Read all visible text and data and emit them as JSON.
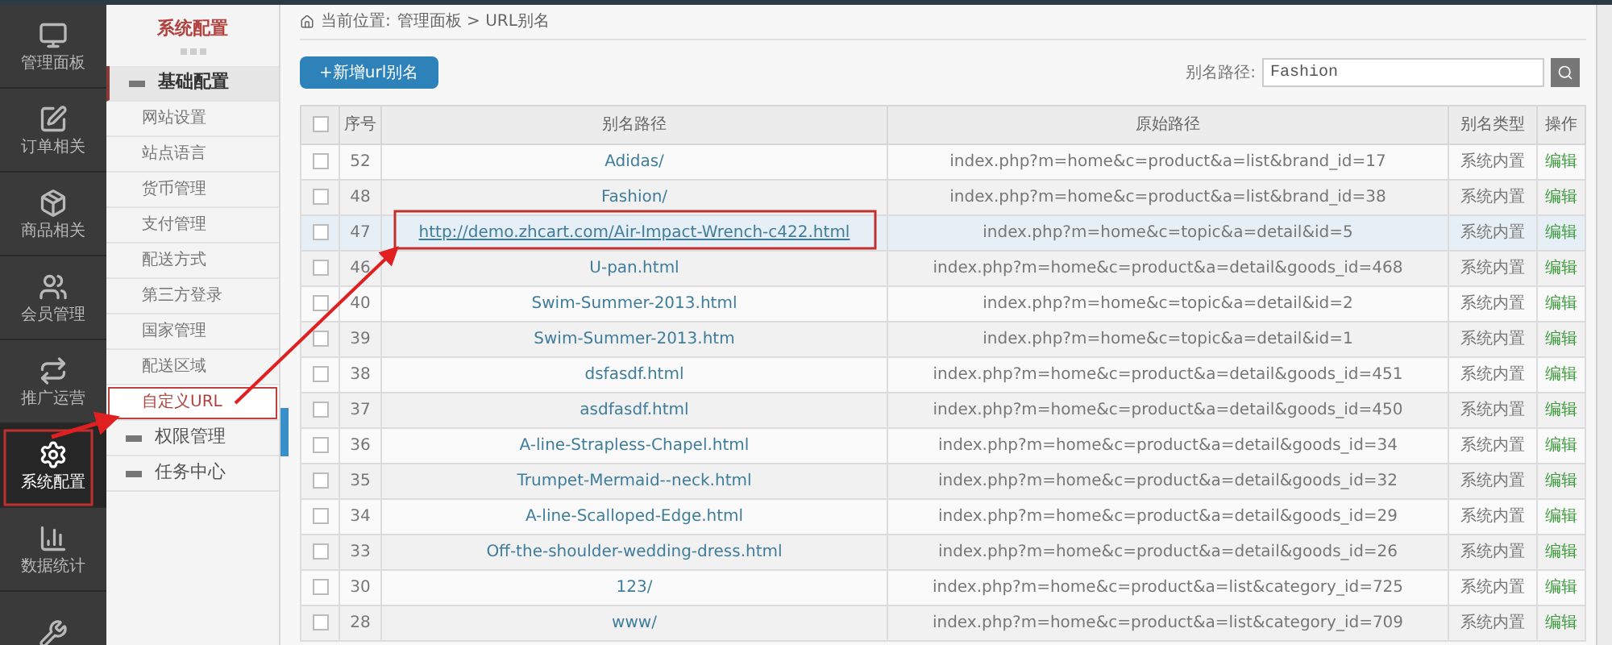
{
  "sidebar": {
    "items": [
      {
        "label": "管理面板",
        "selected": false
      },
      {
        "label": "订单相关",
        "selected": false
      },
      {
        "label": "商品相关",
        "selected": false
      },
      {
        "label": "会员管理",
        "selected": false
      },
      {
        "label": "推广运营",
        "selected": false
      },
      {
        "label": "系统配置",
        "selected": true
      },
      {
        "label": "数据统计",
        "selected": false
      },
      {
        "selected": false
      }
    ]
  },
  "subnav": {
    "title": "系统配置",
    "groups": [
      {
        "label": "基础配置",
        "expanded": true,
        "children": [
          {
            "label": "网站设置",
            "selected": false
          },
          {
            "label": "站点语言",
            "selected": false
          },
          {
            "label": "货币管理",
            "selected": false
          },
          {
            "label": "支付管理",
            "selected": false
          },
          {
            "label": "配送方式",
            "selected": false
          },
          {
            "label": "第三方登录",
            "selected": false
          },
          {
            "label": "国家管理",
            "selected": false
          },
          {
            "label": "配送区域",
            "selected": false
          },
          {
            "label": "自定义URL",
            "selected": true
          }
        ]
      },
      {
        "label": "权限管理",
        "expanded": false
      },
      {
        "label": "任务中心",
        "expanded": false
      }
    ]
  },
  "breadcrumb": {
    "label": "当前位置:",
    "path": "管理面板 > URL别名"
  },
  "add_button": "+新增url别名",
  "search": {
    "label": "别名路径:",
    "value": "Fashion"
  },
  "table": {
    "all_checked": false,
    "columns": [
      "序号",
      "别名路径",
      "原始路径",
      "别名类型",
      "操作"
    ],
    "rows": [
      {
        "checked": false,
        "selected": false,
        "id": "52",
        "alias": "Adidas/",
        "original": "index.php?m=home&c=product&a=list&brand_id=17",
        "type": "系统内置",
        "action": "编辑"
      },
      {
        "checked": false,
        "selected": false,
        "id": "48",
        "alias": "Fashion/",
        "original": "index.php?m=home&c=product&a=list&brand_id=38",
        "type": "系统内置",
        "action": "编辑"
      },
      {
        "checked": false,
        "selected": true,
        "id": "47",
        "alias": "http://demo.zhcart.com/Air-Impact-Wrench-c422.html",
        "original": "index.php?m=home&c=topic&a=detail&id=5",
        "type": "系统内置",
        "action": "编辑"
      },
      {
        "checked": false,
        "selected": false,
        "id": "46",
        "alias": "U-pan.html",
        "original": "index.php?m=home&c=product&a=detail&goods_id=468",
        "type": "系统内置",
        "action": "编辑"
      },
      {
        "checked": false,
        "selected": false,
        "id": "40",
        "alias": "Swim-Summer-2013.html",
        "original": "index.php?m=home&c=topic&a=detail&id=2",
        "type": "系统内置",
        "action": "编辑"
      },
      {
        "checked": false,
        "selected": false,
        "id": "39",
        "alias": "Swim-Summer-2013.htm",
        "original": "index.php?m=home&c=topic&a=detail&id=1",
        "type": "系统内置",
        "action": "编辑"
      },
      {
        "checked": false,
        "selected": false,
        "id": "38",
        "alias": "dsfasdf.html",
        "original": "index.php?m=home&c=product&a=detail&goods_id=451",
        "type": "系统内置",
        "action": "编辑"
      },
      {
        "checked": false,
        "selected": false,
        "id": "37",
        "alias": "asdfasdf.html",
        "original": "index.php?m=home&c=product&a=detail&goods_id=450",
        "type": "系统内置",
        "action": "编辑"
      },
      {
        "checked": false,
        "selected": false,
        "id": "36",
        "alias": "A-line-Strapless-Chapel.html",
        "original": "index.php?m=home&c=product&a=detail&goods_id=34",
        "type": "系统内置",
        "action": "编辑"
      },
      {
        "checked": false,
        "selected": false,
        "id": "35",
        "alias": "Trumpet-Mermaid--neck.html",
        "original": "index.php?m=home&c=product&a=detail&goods_id=32",
        "type": "系统内置",
        "action": "编辑"
      },
      {
        "checked": false,
        "selected": false,
        "id": "34",
        "alias": "A-line-Scalloped-Edge.html",
        "original": "index.php?m=home&c=product&a=detail&goods_id=29",
        "type": "系统内置",
        "action": "编辑"
      },
      {
        "checked": false,
        "selected": false,
        "id": "33",
        "alias": "Off-the-shoulder-wedding-dress.html",
        "original": "index.php?m=home&c=product&a=detail&goods_id=26",
        "type": "系统内置",
        "action": "编辑"
      },
      {
        "checked": false,
        "selected": false,
        "id": "30",
        "alias": "123/",
        "original": "index.php?m=home&c=product&a=list&category_id=725",
        "type": "系统内置",
        "action": "编辑"
      },
      {
        "checked": false,
        "selected": false,
        "id": "28",
        "alias": "www/",
        "original": "index.php?m=home&c=product&a=list&category_id=709",
        "type": "系统内置",
        "action": "编辑"
      }
    ]
  }
}
